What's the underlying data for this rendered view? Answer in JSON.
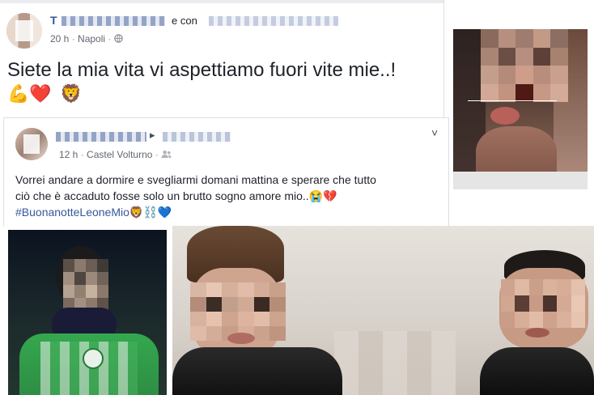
{
  "post1": {
    "author_initial": "T",
    "author_suffix": "e con",
    "time": "20 h",
    "location": "Napoli",
    "globe_icon": "globe-icon",
    "text": "Siete la mia vita vi aspettiamo fuori vite mie..!",
    "emojis": [
      "💪",
      "❤️",
      "🦁"
    ]
  },
  "post2": {
    "author_fragment": "▸ ",
    "time": "12 h",
    "location": "Castel Volturno",
    "friends_icon": "friends-icon",
    "chevron": "˅",
    "text_line1": "Vorrei andare a dormire e svegliarmi domani mattina e sperare che tutto",
    "text_line2": "ciò che è accaduto fosse solo un brutto sogno amore mio..😭💔",
    "hashtag": "#BuonanotteLeoneMio",
    "hashtag_emojis": "🦁⛓️💙"
  },
  "colors": {
    "link": "#365899",
    "meta": "#616770",
    "text": "#1d2129",
    "border": "#dddfe2"
  }
}
